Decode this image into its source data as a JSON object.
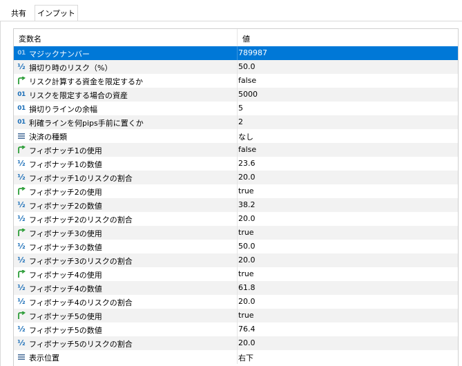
{
  "tabs": [
    {
      "label": "共有",
      "active": false
    },
    {
      "label": "インプット",
      "active": true
    }
  ],
  "table": {
    "headers": {
      "name": "変数名",
      "value": "値"
    },
    "rows": [
      {
        "type": "int",
        "icon": "int-type-icon",
        "name": "マジックナンバー",
        "value": "789987",
        "selected": true
      },
      {
        "type": "double",
        "icon": "double-type-icon",
        "name": "損切り時のリスク（%）",
        "value": "50.0"
      },
      {
        "type": "bool",
        "icon": "bool-type-icon",
        "name": "リスク計算する資金を限定するか",
        "value": "false"
      },
      {
        "type": "int",
        "icon": "int-type-icon",
        "name": "リスクを限定する場合の資産",
        "value": "5000"
      },
      {
        "type": "int",
        "icon": "int-type-icon",
        "name": "損切りラインの余幅",
        "value": "5"
      },
      {
        "type": "int",
        "icon": "int-type-icon",
        "name": "利確ラインを何pips手前に置くか",
        "value": "2"
      },
      {
        "type": "enum",
        "icon": "enum-type-icon",
        "name": "決済の種類",
        "value": "なし"
      },
      {
        "type": "bool",
        "icon": "bool-type-icon",
        "name": "フィボナッチ1の使用",
        "value": "false"
      },
      {
        "type": "double",
        "icon": "double-type-icon",
        "name": "フィボナッチ1の数値",
        "value": "23.6"
      },
      {
        "type": "double",
        "icon": "double-type-icon",
        "name": "フィボナッチ1のリスクの割合",
        "value": "20.0"
      },
      {
        "type": "bool",
        "icon": "bool-type-icon",
        "name": "フィボナッチ2の使用",
        "value": "true"
      },
      {
        "type": "double",
        "icon": "double-type-icon",
        "name": "フィボナッチ2の数値",
        "value": "38.2"
      },
      {
        "type": "double",
        "icon": "double-type-icon",
        "name": "フィボナッチ2のリスクの割合",
        "value": "20.0"
      },
      {
        "type": "bool",
        "icon": "bool-type-icon",
        "name": "フィボナッチ3の使用",
        "value": "true"
      },
      {
        "type": "double",
        "icon": "double-type-icon",
        "name": "フィボナッチ3の数値",
        "value": "50.0"
      },
      {
        "type": "double",
        "icon": "double-type-icon",
        "name": "フィボナッチ3のリスクの割合",
        "value": "20.0"
      },
      {
        "type": "bool",
        "icon": "bool-type-icon",
        "name": "フィボナッチ4の使用",
        "value": "true"
      },
      {
        "type": "double",
        "icon": "double-type-icon",
        "name": "フィボナッチ4の数値",
        "value": "61.8"
      },
      {
        "type": "double",
        "icon": "double-type-icon",
        "name": "フィボナッチ4のリスクの割合",
        "value": "20.0"
      },
      {
        "type": "bool",
        "icon": "bool-type-icon",
        "name": "フィボナッチ5の使用",
        "value": "true"
      },
      {
        "type": "double",
        "icon": "double-type-icon",
        "name": "フィボナッチ5の数値",
        "value": "76.4"
      },
      {
        "type": "double",
        "icon": "double-type-icon",
        "name": "フィボナッチ5のリスクの割合",
        "value": "20.0"
      },
      {
        "type": "enum",
        "icon": "enum-type-icon",
        "name": "表示位置",
        "value": "右下"
      }
    ]
  },
  "colors": {
    "selection": "#0078d7",
    "alt_row": "#f2f2f2",
    "int_icon": "#1c6fb8",
    "bool_icon": "#2e9e3a"
  }
}
